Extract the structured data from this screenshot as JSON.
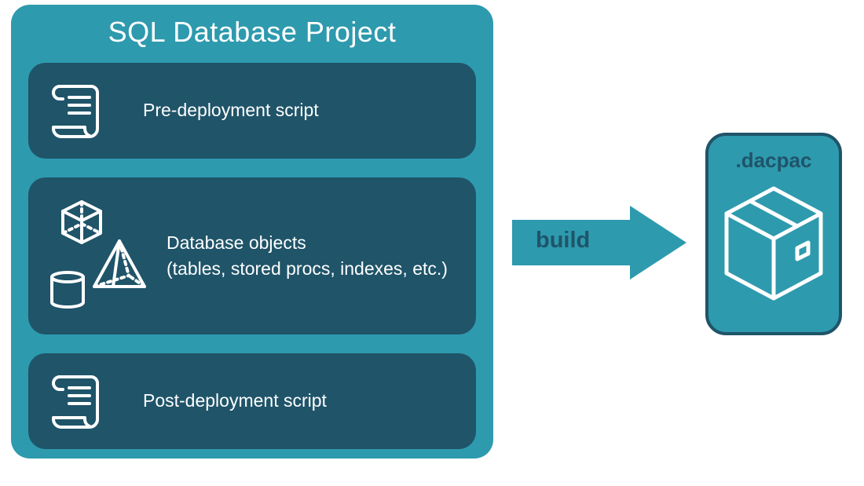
{
  "title": "SQL Database Project",
  "stages": {
    "pre": {
      "label": "Pre-deployment script"
    },
    "objects": {
      "line1": "Database objects",
      "line2": "(tables, stored procs, indexes, etc.)"
    },
    "post": {
      "label": "Post-deployment script"
    }
  },
  "arrow_label": "build",
  "output_label": ".dacpac",
  "colors": {
    "container": "#2E9AAE",
    "stage": "#1F5469",
    "stroke": "#ffffff"
  }
}
